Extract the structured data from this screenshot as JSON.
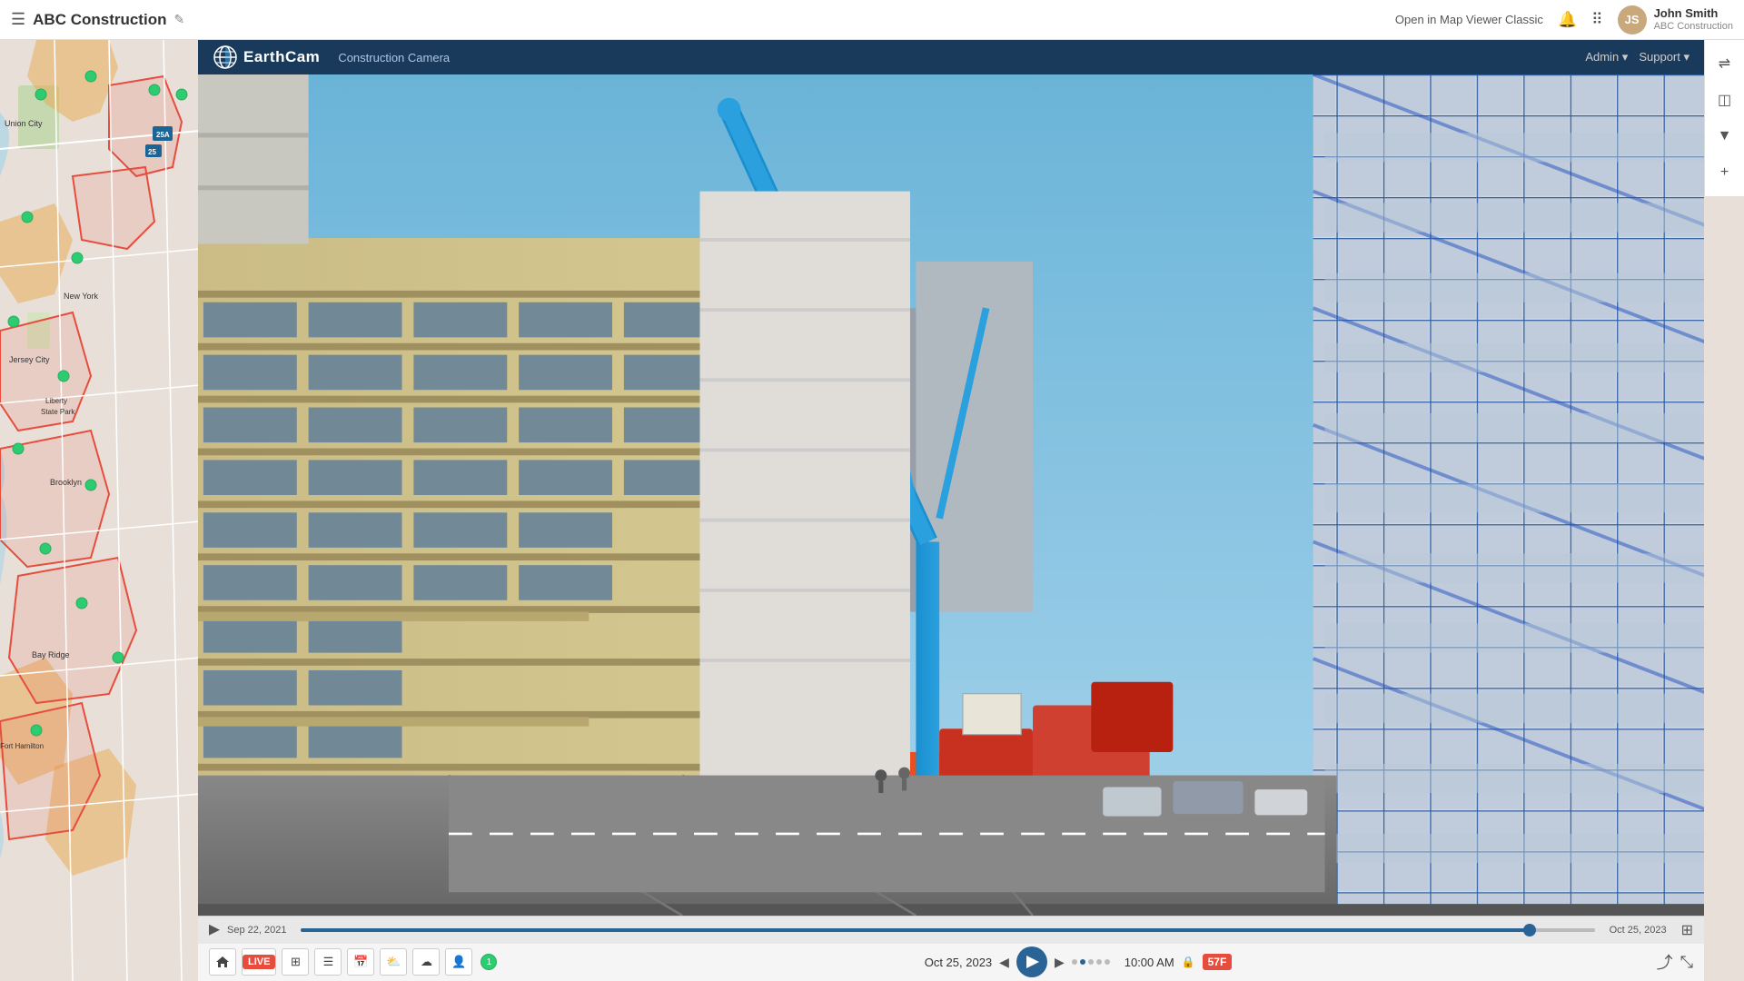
{
  "topbar": {
    "app_title": "ABC Construction",
    "edit_icon": "✎",
    "open_map_viewer": "Open in Map Viewer Classic",
    "bell_icon": "🔔",
    "grid_icon": "⠿",
    "user": {
      "name": "John Smith",
      "org": "ABC Construction",
      "avatar_initials": "JS"
    }
  },
  "right_toolbar": {
    "filter_icon": "⇌",
    "layer_icon": "◫",
    "funnel_icon": "⊽",
    "plus_icon": "+"
  },
  "earthcam": {
    "logo": "EarthCam",
    "title": "Construction Camera",
    "admin_label": "Admin ▾",
    "support_label": "Support ▾",
    "camera_view_alt": "Construction site camera view showing building facade and crane"
  },
  "controls": {
    "live_label": "LIVE",
    "date_start": "Sep 22, 2021",
    "date_end": "Oct 25, 2023",
    "center_date": "Oct 25, 2023",
    "center_time": "10:00 AM",
    "lock_icon": "🔒",
    "temperature": "57F",
    "play_icon": "▶",
    "prev_icon": "◀",
    "next_icon": "▶",
    "share_icon": "⤴",
    "expand_icon": "⤡",
    "fullscreen_icon": "⊞"
  }
}
